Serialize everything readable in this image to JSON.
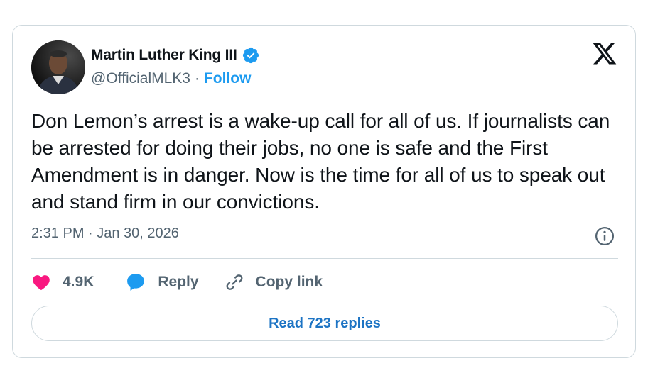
{
  "author": {
    "display_name": "Martin Luther King III",
    "handle": "@OfficialMLK3",
    "separator": "·",
    "follow_label": "Follow",
    "verified": true
  },
  "tweet": {
    "text": "Don Lemon’s arrest is a wake-up call for all of us. If journalists can be arrested for doing their jobs, no one is safe and the First Amendment is in danger. Now is the time for all of us to speak out and stand firm in our convictions.",
    "timestamp": "2:31 PM · Jan 30, 2026"
  },
  "actions": {
    "like_count": "4.9K",
    "reply_label": "Reply",
    "copy_link_label": "Copy link"
  },
  "read_replies_label": "Read 723 replies",
  "colors": {
    "accent": "#1d9bf0",
    "like": "#f91880",
    "text": "#0f1419",
    "muted": "#536471"
  }
}
